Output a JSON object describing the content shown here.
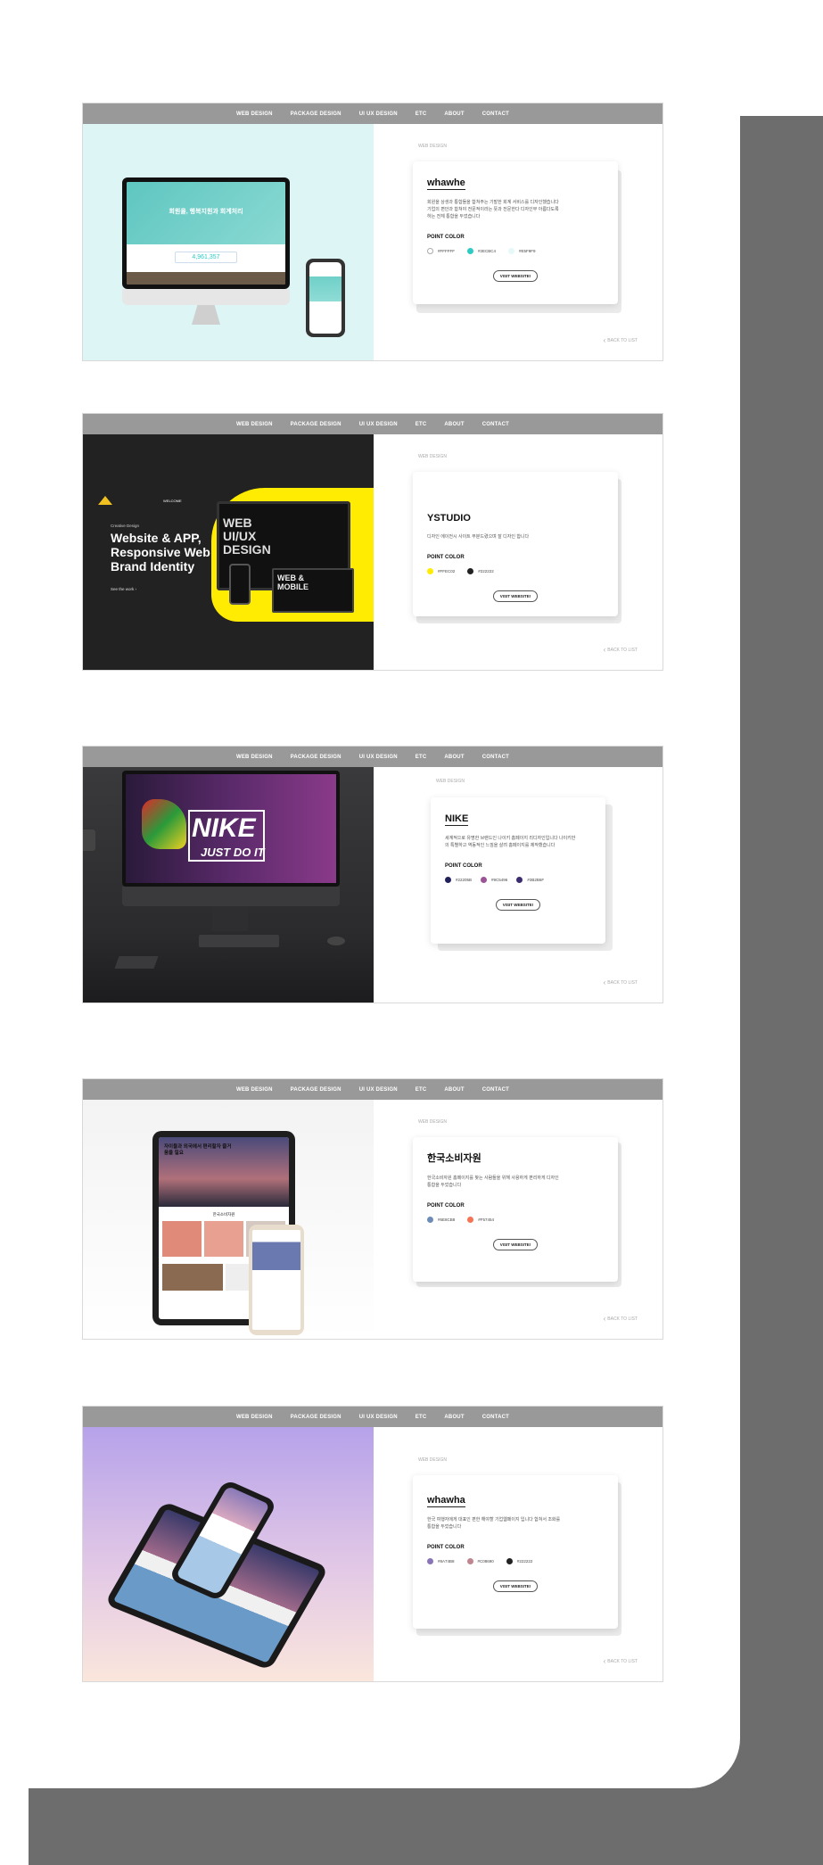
{
  "nav": [
    "WEB DESIGN",
    "PACKAGE DESIGN",
    "UI UX DESIGN",
    "ETC",
    "ABOUT",
    "CONTACT"
  ],
  "common": {
    "section_label": "WEB DESIGN",
    "point_color_label": "POINT COLOR",
    "visit_label": "VISIT WEBSITE!",
    "back_label": "BACK TO LIST"
  },
  "projects": [
    {
      "title": "whawhe",
      "description": "회원을 상생과 통합들을 합쳐주는 기발한 회계 서비스를 디자인했습니다 기업의 편안과 합쳐야 전문적이라는 뜻과 전문한다 디자인부 아름다도록하는 전체 통합을 두었습니다",
      "colors": [
        {
          "hex": "#FFFFFF",
          "label": "#FFFFFF"
        },
        {
          "hex": "#2ECBC4",
          "label": "#2ECBC4"
        },
        {
          "hex": "#E5F9F9",
          "label": "#E5F9F9"
        }
      ],
      "screen_text": "회원을, 행복지원과 회계처리",
      "screen_number": "4,961,357"
    },
    {
      "title": "YSTUDIO",
      "description": "디자인 에이전시 사이트 부분드렸으며 잘 디자인 합니다",
      "colors": [
        {
          "hex": "#FFEC02",
          "label": "#FFEC02"
        },
        {
          "hex": "#222222",
          "label": "#222222"
        }
      ],
      "hero_small": "Creative Design",
      "hero_title": "Website & APP, Responsive Web and Brand Identity",
      "hero_link": "See the work",
      "hero_welcome": "WELCOME",
      "hero_design": "WEB UI/UX DESIGN",
      "hero_design2": "WEB & MOBILE"
    },
    {
      "title": "NIKE",
      "description": "세계적으로 유명한 브랜드인 나이키 홈페이지 리디자인입니다 나이키만의 특별하고 역동적인 느낌을 살려 홈페이지를 제작했습니다",
      "colors": [
        {
          "hex": "#22205B",
          "label": "#22205B"
        },
        {
          "hex": "#9C5496",
          "label": "#9C5496"
        },
        {
          "hex": "#3B2B6F",
          "label": "#3B2B6F"
        }
      ],
      "screen_brand": "NIKE",
      "screen_slogan": "JUST DO IT"
    },
    {
      "title": "한국소비자원",
      "description": "한국소비자원 홈페이지를 찾는 사람들을 위해 사용하게 편리하게 디자인 통합을 두었습니다",
      "colors": [
        {
          "hex": "#6E8CB8",
          "label": "#6E8CB8"
        },
        {
          "hex": "#F57454",
          "label": "#F57454"
        }
      ],
      "screen_heading": "자이들과 외국에서 편리할자 즐거움을 필요",
      "screen_sub": "한국소비자원"
    },
    {
      "title": "whawha",
      "description": "한국 여행자에게 대표인 편한 해야할 기업웹페이지 입니다 합쳐서 조화를 통합을 두었습니다",
      "colors": [
        {
          "hex": "#8A74B8",
          "label": "#8A74B8"
        },
        {
          "hex": "#C08690",
          "label": "#C08690"
        },
        {
          "hex": "#222222",
          "label": "#222222"
        }
      ]
    }
  ]
}
